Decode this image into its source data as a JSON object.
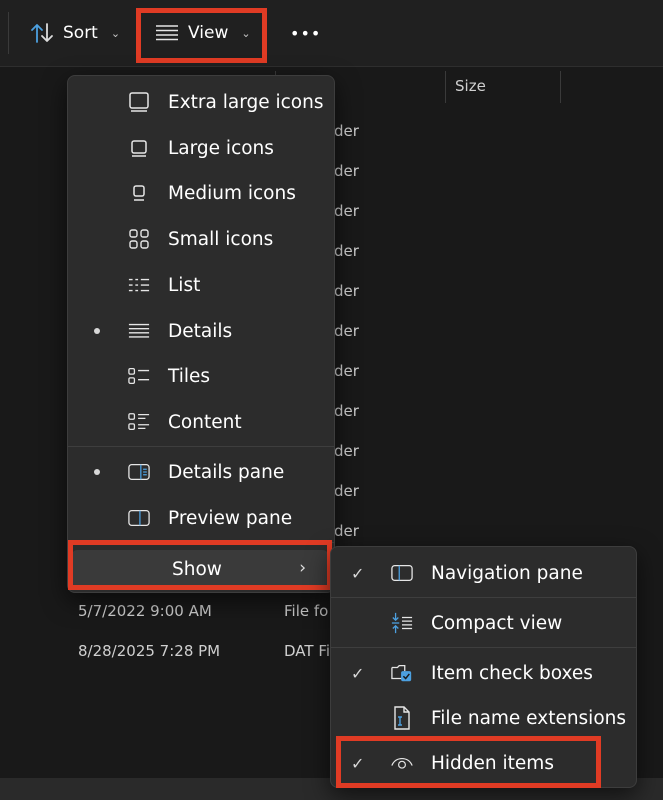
{
  "toolbar": {
    "sort_label": "Sort",
    "view_label": "View",
    "more_label": "•••"
  },
  "columns": {
    "size_label": "Size"
  },
  "files": {
    "type_fragments": [
      "der",
      "der",
      "der",
      "der",
      "der",
      "der",
      "der",
      "der",
      "der",
      "der",
      "der"
    ],
    "rows": [
      {
        "date": "5/7/2022 9:00 AM",
        "type": "File fo"
      },
      {
        "date": "8/28/2025 7:28 PM",
        "type": "DAT Fi"
      }
    ]
  },
  "view_menu": {
    "items": [
      {
        "label": "Extra large icons",
        "icon": "extra-large-icons-icon",
        "selected": false
      },
      {
        "label": "Large icons",
        "icon": "large-icons-icon",
        "selected": false
      },
      {
        "label": "Medium icons",
        "icon": "medium-icons-icon",
        "selected": false
      },
      {
        "label": "Small icons",
        "icon": "small-icons-icon",
        "selected": false
      },
      {
        "label": "List",
        "icon": "list-icon",
        "selected": false
      },
      {
        "label": "Details",
        "icon": "details-icon",
        "selected": true
      },
      {
        "label": "Tiles",
        "icon": "tiles-icon",
        "selected": false
      },
      {
        "label": "Content",
        "icon": "content-icon",
        "selected": false
      }
    ],
    "panes": [
      {
        "label": "Details pane",
        "icon": "details-pane-icon",
        "selected": true
      },
      {
        "label": "Preview pane",
        "icon": "preview-pane-icon",
        "selected": false
      }
    ],
    "show_label": "Show"
  },
  "show_menu": {
    "items": [
      {
        "label": "Navigation pane",
        "icon": "navigation-pane-icon",
        "checked": true
      },
      {
        "label": "Compact view",
        "icon": "compact-view-icon",
        "checked": false
      },
      {
        "label": "Item check boxes",
        "icon": "item-check-boxes-icon",
        "checked": true
      },
      {
        "label": "File name extensions",
        "icon": "file-name-extensions-icon",
        "checked": false
      },
      {
        "label": "Hidden items",
        "icon": "hidden-items-icon",
        "checked": true
      }
    ]
  },
  "colors": {
    "highlight": "#e03b24",
    "accent": "#4ca0e0",
    "menu_bg": "#2c2c2c"
  }
}
